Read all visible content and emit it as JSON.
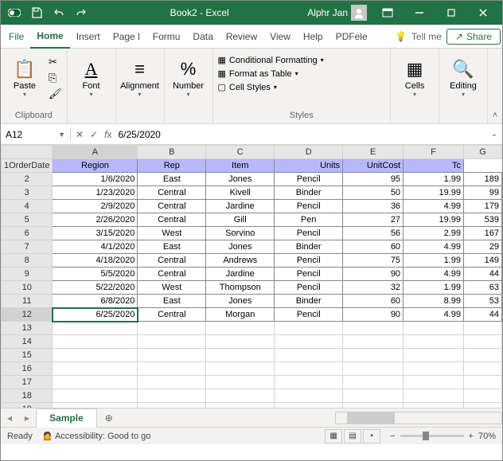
{
  "titlebar": {
    "title": "Book2 - Excel",
    "user": "Alphr Jan"
  },
  "menu": {
    "file": "File",
    "home": "Home",
    "insert": "Insert",
    "pagelayout": "Page l",
    "formulas": "Formu",
    "data": "Data",
    "review": "Review",
    "view": "View",
    "help": "Help",
    "pdfelement": "PDFele",
    "tellme": "Tell me",
    "share": "Share"
  },
  "ribbon": {
    "clipboard": {
      "label": "Clipboard",
      "paste": "Paste"
    },
    "font": {
      "label": "Font"
    },
    "alignment": {
      "label": "Alignment"
    },
    "number": {
      "label": "Number"
    },
    "styles": {
      "label": "Styles",
      "cond": "Conditional Formatting",
      "table": "Format as Table",
      "cell": "Cell Styles"
    },
    "cells": {
      "label": "Cells"
    },
    "editing": {
      "label": "Editing"
    }
  },
  "namebox": {
    "cell": "A12",
    "formula": "6/25/2020"
  },
  "columns": [
    "A",
    "B",
    "C",
    "D",
    "E",
    "F",
    "G"
  ],
  "headers": [
    "OrderDate",
    "Region",
    "Rep",
    "Item",
    "Units",
    "UnitCost",
    "Tc"
  ],
  "rows": [
    {
      "n": 1
    },
    {
      "n": 2,
      "d": [
        "1/6/2020",
        "East",
        "Jones",
        "Pencil",
        "95",
        "1.99",
        "189"
      ]
    },
    {
      "n": 3,
      "d": [
        "1/23/2020",
        "Central",
        "Kivell",
        "Binder",
        "50",
        "19.99",
        "99"
      ]
    },
    {
      "n": 4,
      "d": [
        "2/9/2020",
        "Central",
        "Jardine",
        "Pencil",
        "36",
        "4.99",
        "179"
      ]
    },
    {
      "n": 5,
      "d": [
        "2/26/2020",
        "Central",
        "Gill",
        "Pen",
        "27",
        "19.99",
        "539"
      ]
    },
    {
      "n": 6,
      "d": [
        "3/15/2020",
        "West",
        "Sorvino",
        "Pencil",
        "56",
        "2.99",
        "167"
      ]
    },
    {
      "n": 7,
      "d": [
        "4/1/2020",
        "East",
        "Jones",
        "Binder",
        "60",
        "4.99",
        "29"
      ]
    },
    {
      "n": 8,
      "d": [
        "4/18/2020",
        "Central",
        "Andrews",
        "Pencil",
        "75",
        "1.99",
        "149"
      ]
    },
    {
      "n": 9,
      "d": [
        "5/5/2020",
        "Central",
        "Jardine",
        "Pencil",
        "90",
        "4.99",
        "44"
      ]
    },
    {
      "n": 10,
      "d": [
        "5/22/2020",
        "West",
        "Thompson",
        "Pencil",
        "32",
        "1.99",
        "63"
      ]
    },
    {
      "n": 11,
      "d": [
        "6/8/2020",
        "East",
        "Jones",
        "Binder",
        "60",
        "8.99",
        "53"
      ]
    },
    {
      "n": 12,
      "d": [
        "6/25/2020",
        "Central",
        "Morgan",
        "Pencil",
        "90",
        "4.99",
        "44"
      ]
    }
  ],
  "active": {
    "row": 12,
    "col": "A"
  },
  "sheets": {
    "active": "Sample"
  },
  "status": {
    "ready": "Ready",
    "access": "Accessibility: Good to go",
    "zoom": "70%"
  }
}
